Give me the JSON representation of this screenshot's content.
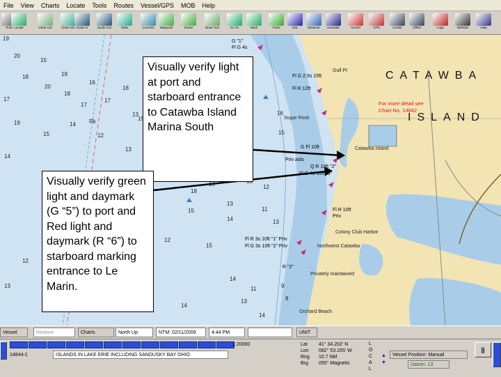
{
  "menu": [
    "File",
    "View",
    "Charts",
    "Locate",
    "Tools",
    "Routes",
    "Vessel/GPS",
    "MOB",
    "Help"
  ],
  "toolbar": {
    "buttons": [
      {
        "label": "Print",
        "icon": "printer-icon"
      },
      {
        "label": "Locate",
        "icon": "locate-icon"
      },
      {
        "label": "Chart List",
        "icon": "chart-list-icon"
      },
      {
        "label": "Chart Info",
        "icon": "chart-info-icon"
      },
      {
        "label": "Scale In",
        "icon": "zoom-in-icon"
      },
      {
        "label": "Scale Out",
        "icon": "zoom-out-icon"
      },
      {
        "label": "Tides",
        "icon": "tides-icon"
      },
      {
        "label": "Currents",
        "icon": "currents-icon"
      },
      {
        "label": "Waypoint",
        "icon": "waypoint-icon"
      },
      {
        "label": "Route",
        "icon": "route-icon"
      },
      {
        "label": "Draw Tool",
        "icon": "draw-icon"
      },
      {
        "label": "Go To",
        "icon": "goto-icon"
      },
      {
        "label": "Mark",
        "icon": "mark-icon"
      },
      {
        "label": "Track",
        "icon": "track-icon"
      },
      {
        "label": "Nav",
        "icon": "nav-icon"
      },
      {
        "label": "Measure",
        "icon": "measure-icon"
      },
      {
        "label": "Annotate",
        "icon": "annotate-icon"
      },
      {
        "label": "Anchor",
        "icon": "anchor-icon"
      },
      {
        "label": "GPS",
        "icon": "gps-icon"
      },
      {
        "label": "Center",
        "icon": "center-icon"
      },
      {
        "label": "Offset",
        "icon": "offset-icon"
      },
      {
        "label": "Logo",
        "icon": "logo-icon"
      },
      {
        "label": "Website",
        "icon": "website-icon"
      },
      {
        "label": "Help",
        "icon": "help-icon"
      }
    ]
  },
  "chart": {
    "big_label": "CATAWBA",
    "island_label": "ISLAND",
    "note_line1": "For more detail see",
    "note_line2": "Chart No. 14842",
    "places": [
      "Gull Pt",
      "Sugar Rock",
      "Catawba Island",
      "Colony Club Harbor",
      "Northwest Catawba",
      "Privately maintained",
      "Orchard Beach"
    ],
    "lights": [
      {
        "text": "G \"1\"",
        "sub": "Fl G 4s"
      },
      {
        "text": "Fl G 2.5s 15ft",
        "sub": "Fl R 12ft"
      },
      {
        "text": "G Fl 10ft"
      },
      {
        "text": "Priv aids"
      },
      {
        "text": "Q R 10ft \"2\""
      },
      {
        "text": "Fl G 4s 10ft \"5\""
      },
      {
        "text": "Fl R 10ft",
        "sub": "Priv"
      },
      {
        "text": "Fl R 3s 10ft \"1\" Priv"
      },
      {
        "text": "Fl G 3s 10ft \"2\" Priv"
      },
      {
        "text": "R \"2\""
      }
    ],
    "depths": [
      "19",
      "20",
      "18",
      "17",
      "15",
      "19",
      "20",
      "18",
      "17",
      "16",
      "Rk",
      "17",
      "18",
      "20",
      "18",
      "13",
      "19",
      "14",
      "15",
      "14",
      "13",
      "12",
      "15",
      "12",
      "13",
      "11",
      "14",
      "17",
      "11",
      "13",
      "16",
      "18",
      "15",
      "13",
      "13",
      "14",
      "12",
      "11",
      "13",
      "16",
      "15",
      "14",
      "15",
      "16",
      "13",
      "14",
      "13",
      "12",
      "15",
      "14",
      "13",
      "11",
      "14",
      "9",
      "8",
      "14",
      "12",
      "13"
    ]
  },
  "callouts": {
    "top": "Visually verify light at port and starboard entrance to Catawba Island Marina South",
    "left": "Visually verify green light and daymark (G “5”) to port and Red light and daymark (R “6”) to starboard marking entrance to Le Marin."
  },
  "controls": {
    "vessel_btn": "Vessel",
    "mode": "Relative",
    "charts_btn": "Charts",
    "orientation": "North Up",
    "datetime": "NTM: 02/11/2009",
    "time": "4:44 PM",
    "units": "UNIT"
  },
  "status": {
    "scale": "1:20000",
    "chart_no": "14844-1",
    "chart_title": "ISLANDS IN LAKE ERIE INCLUDING SANDUSKY BAY OHIO",
    "lat_label": "Lat",
    "lat": "41° 34.202' N",
    "lon_label": "Lon",
    "lon": "082° 53.155' W",
    "rng_label": "Rng",
    "rng": "10.7 NM",
    "brg_label": "Brg",
    "brg": "055° Magnetic",
    "side_label": "LOCAL",
    "vessel_position": "Vessel Position: Manual",
    "datum": "Datum: 13",
    "pause": "||"
  },
  "colors": {
    "water": "#cfe3f2",
    "shallow": "#a9cde8",
    "land": "#f3e4b4",
    "callout_arrow": "#000000",
    "toolbar_bg": "#d4d0c8",
    "status_blue": "#2a4ed6"
  }
}
